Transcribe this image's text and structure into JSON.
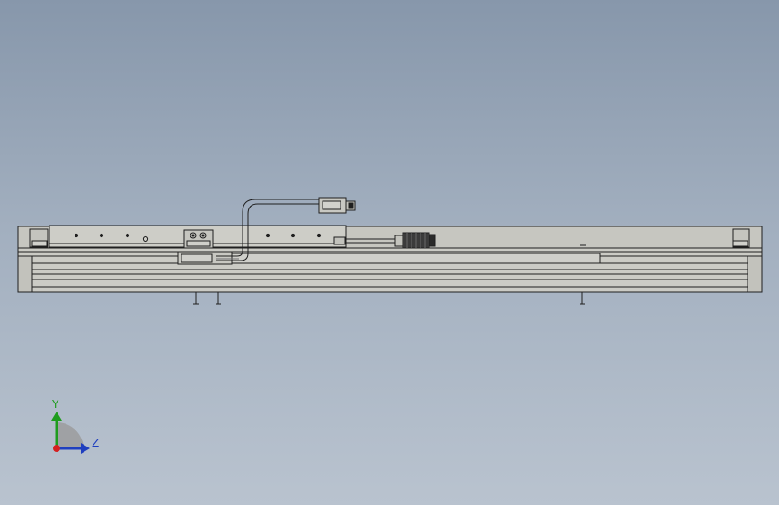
{
  "viewport": {
    "background_top": "#8797ab",
    "background_bottom": "#b9c3cf"
  },
  "model": {
    "part_color": "#c9c9c3",
    "edge_color": "#1f1f1f",
    "components": [
      "linear-module-base",
      "slider-carriage",
      "cable-chain",
      "sensor-connector",
      "cable-plug",
      "end-caps"
    ]
  },
  "triad": {
    "y_label": "Y",
    "z_label": "Z",
    "y_color": "#1e9c1e",
    "z_color": "#1f3fbf",
    "origin_color": "#d42020"
  }
}
